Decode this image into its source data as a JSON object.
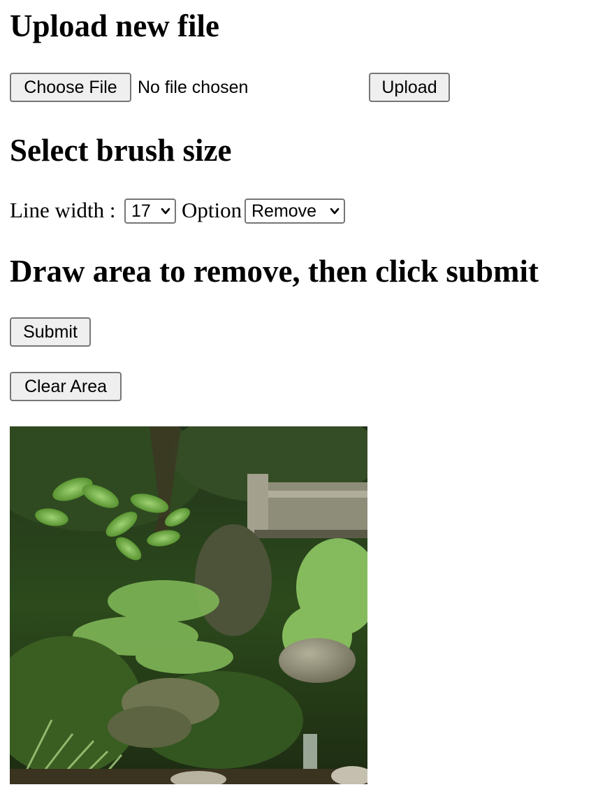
{
  "upload": {
    "heading": "Upload new file",
    "choose_file_label": "Choose File",
    "file_status": "No file chosen",
    "upload_label": "Upload"
  },
  "brush": {
    "heading": "Select brush size",
    "line_width_label": "Line width :",
    "line_width_value": "17",
    "option_label": "Option",
    "option_value": "Remove"
  },
  "draw": {
    "heading": "Draw area to remove, then click submit",
    "submit_label": "Submit",
    "clear_label": "Clear Area"
  },
  "canvas": {
    "image_description": "garden-photo",
    "colors": {
      "foliage_dark": "#1e2a12",
      "foliage_mid": "#3f6b22",
      "foliage_light": "#8fc865",
      "stone": "#8a8a72",
      "bridge": "#9a9a86"
    }
  }
}
